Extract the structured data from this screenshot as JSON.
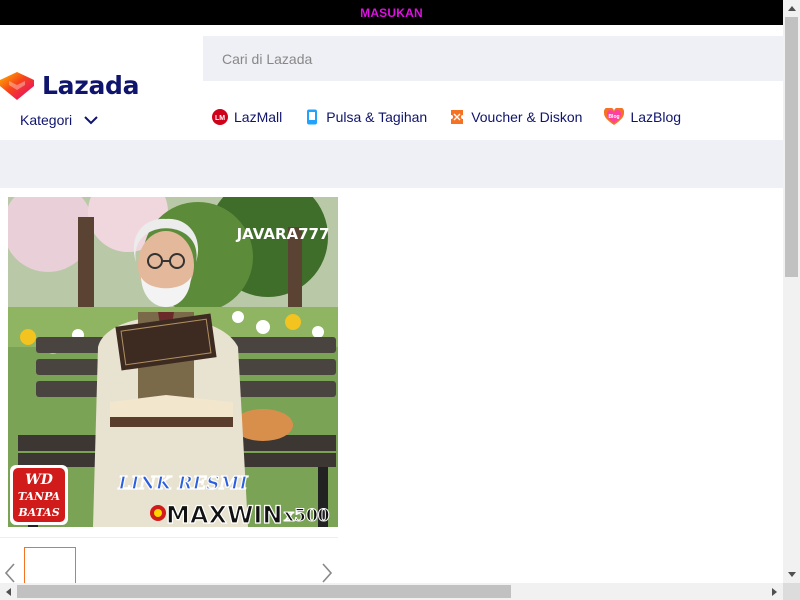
{
  "topbar": {
    "login_label": "MASUKAN"
  },
  "header": {
    "logo_text": "Lazada",
    "search_placeholder": "Cari di Lazada",
    "kategori_label": "Kategori",
    "nav_links": [
      {
        "label": "LazMall",
        "icon": "lazmall-icon"
      },
      {
        "label": "Pulsa & Tagihan",
        "icon": "phone-icon"
      },
      {
        "label": "Voucher & Diskon",
        "icon": "voucher-icon"
      },
      {
        "label": "LazBlog",
        "icon": "lazblog-icon"
      }
    ]
  },
  "banner": {
    "watermark": "JAVARA777",
    "badge_line1": "WD",
    "badge_line2": "TANPA",
    "badge_line3": "BATAS",
    "link_text": "LINK RESMI",
    "maxwin_text": "MAXWIN",
    "multiplier_text": "x500"
  },
  "colors": {
    "brand_navy": "#0f146d",
    "accent_orange": "#f57224",
    "login_magenta": "#e10fe4",
    "band_gray": "#eff0f5"
  }
}
